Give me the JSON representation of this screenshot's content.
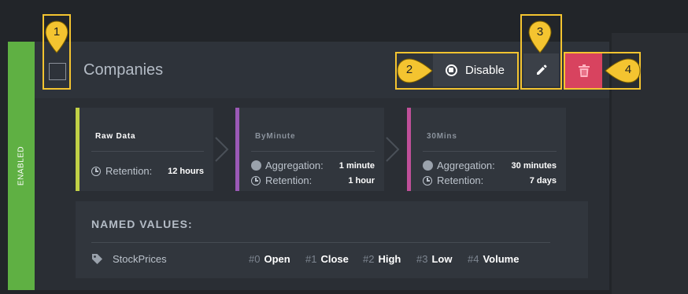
{
  "status": {
    "label": "ENABLED",
    "color": "#5fb043"
  },
  "header": {
    "title": "Companies",
    "disable_label": "Disable",
    "disable_icon": "stop-circle-icon",
    "edit_icon": "pencil-icon",
    "delete_icon": "trash-icon",
    "delete_color": "#d8435f"
  },
  "markers": [
    "1",
    "2",
    "3",
    "4"
  ],
  "stages": [
    {
      "title": "Raw Data",
      "color": "#c2d146",
      "rows": [
        {
          "icon": "clock-icon",
          "label": "Retention:",
          "value": "12 hours"
        }
      ]
    },
    {
      "title": "ByMinute",
      "color": "#9b59b6",
      "rows": [
        {
          "icon": "dot-icon",
          "label": "Aggregation:",
          "value": "1 minute"
        },
        {
          "icon": "clock-icon",
          "label": "Retention:",
          "value": "1 hour"
        }
      ]
    },
    {
      "title": "30Mins",
      "color": "#c0509a",
      "rows": [
        {
          "icon": "dot-icon",
          "label": "Aggregation:",
          "value": "30 minutes"
        },
        {
          "icon": "clock-icon",
          "label": "Retention:",
          "value": "7 days"
        }
      ]
    }
  ],
  "named_values": {
    "title": "NAMED VALUES:",
    "tag_icon": "tag-icon",
    "name": "StockPrices",
    "items": [
      {
        "index": "#0",
        "name": "Open"
      },
      {
        "index": "#1",
        "name": "Close"
      },
      {
        "index": "#2",
        "name": "High"
      },
      {
        "index": "#3",
        "name": "Low"
      },
      {
        "index": "#4",
        "name": "Volume"
      }
    ]
  }
}
